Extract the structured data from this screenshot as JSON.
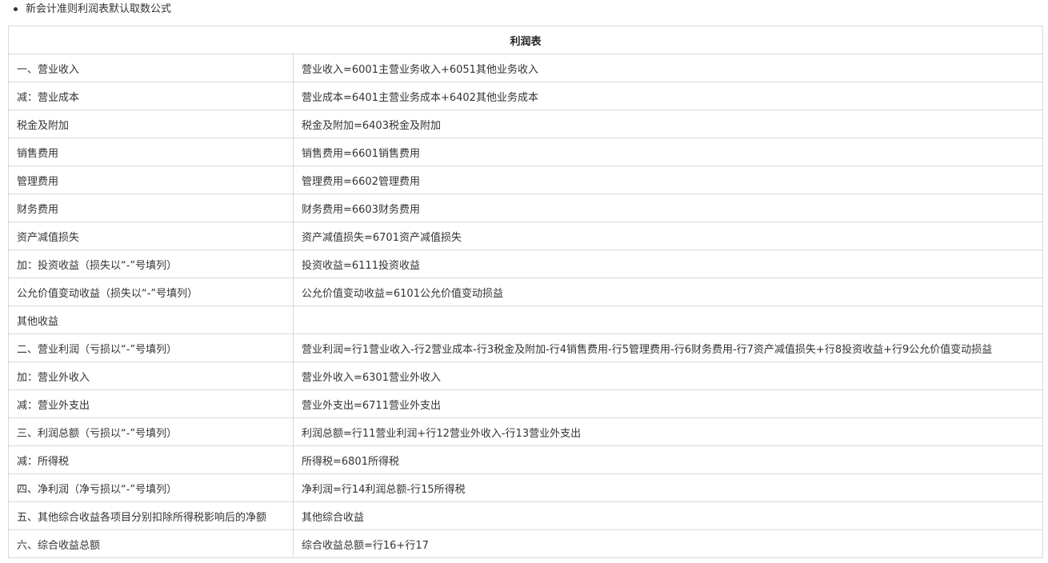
{
  "intro": {
    "bullet_text": "新会计准则利润表默认取数公式"
  },
  "table": {
    "title": "利润表",
    "rows": [
      {
        "item": "一、营业收入",
        "formula": "营业收入=6001主营业务收入+6051其他业务收入"
      },
      {
        "item": "减：营业成本",
        "formula": "营业成本=6401主营业务成本+6402其他业务成本"
      },
      {
        "item": "税金及附加",
        "formula": "税金及附加=6403税金及附加"
      },
      {
        "item": "销售费用",
        "formula": "销售费用=6601销售费用"
      },
      {
        "item": "管理费用",
        "formula": "管理费用=6602管理费用"
      },
      {
        "item": "财务费用",
        "formula": "财务费用=6603财务费用"
      },
      {
        "item": "资产减值损失",
        "formula": "资产减值损失=6701资产减值损失"
      },
      {
        "item": "加：投资收益（损失以“-”号填列）",
        "formula": "投资收益=6111投资收益"
      },
      {
        "item": "公允价值变动收益（损失以“-”号填列）",
        "formula": "公允价值变动收益=6101公允价值变动损益"
      },
      {
        "item": "其他收益",
        "formula": ""
      },
      {
        "item": "二、营业利润（亏损以“-”号填列）",
        "formula": "营业利润=行1营业收入-行2营业成本-行3税金及附加-行4销售费用-行5管理费用-行6财务费用-行7资产减值损失+行8投资收益+行9公允价值变动损益"
      },
      {
        "item": "加：营业外收入",
        "formula": "营业外收入=6301营业外收入"
      },
      {
        "item": "减：营业外支出",
        "formula": "营业外支出=6711营业外支出"
      },
      {
        "item": "三、利润总额（亏损以“-”号填列）",
        "formula": "利润总额=行11营业利润+行12营业外收入-行13营业外支出"
      },
      {
        "item": "减：所得税",
        "formula": "所得税=6801所得税"
      },
      {
        "item": "四、净利润（净亏损以“-”号填列）",
        "formula": "净利润=行14利润总额-行15所得税"
      },
      {
        "item": "五、其他综合收益各项目分别扣除所得税影响后的净额",
        "formula": "其他综合收益"
      },
      {
        "item": "六、综合收益总额",
        "formula": "综合收益总额=行16+行17"
      }
    ]
  }
}
